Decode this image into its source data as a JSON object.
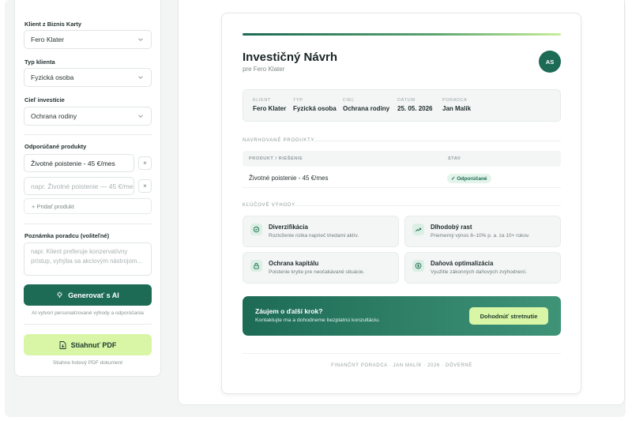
{
  "sidebar": {
    "client_label": "Klient z Biznis Karty",
    "client_value": "Fero Klater",
    "type_label": "Typ klienta",
    "type_value": "Fyzická osoba",
    "goal_label": "Cieľ investície",
    "goal_value": "Ochrana rodiny",
    "products_label": "Odporúčané produkty",
    "products": [
      {
        "value": "Životné poistenie - 45 €/mes"
      }
    ],
    "product_placeholder": "napr. Životné poistenie — 45 €/mes",
    "remove_label": "×",
    "add_product_label": "+ Pridať produkt",
    "note_label": "Poznámka poradcu (voliteľné)",
    "note_placeholder": "napr. Klient preferuje konzervatívny prístup, vyhýba sa akciovým nástrojom...",
    "generate_label": "Generovať s AI",
    "generate_hint": "AI vytvorí personalizované výhody a odporúčania",
    "pdf_label": "Stiahnuť PDF",
    "pdf_hint": "Stiahne hotový PDF dokument"
  },
  "doc": {
    "title": "Investičný Návrh",
    "subtitle": "pre Fero Klater",
    "avatar": "AS",
    "meta": [
      {
        "key": "KLIENT",
        "value": "Fero Klater"
      },
      {
        "key": "TYP",
        "value": "Fyzická osoba"
      },
      {
        "key": "CIEĽ",
        "value": "Ochrana rodiny"
      },
      {
        "key": "DÁTUM",
        "value": "25. 05. 2026"
      },
      {
        "key": "PORADCA",
        "value": "Jan Malík"
      }
    ],
    "products_heading": "NAVRHOVANÉ PRODUKTY",
    "table_headers": [
      "PRODUKT / RIEŠENIE",
      "STAV"
    ],
    "table_rows": [
      {
        "product": "Životné poistenie - 45 €/mes",
        "status": "✓ Odporúčané"
      }
    ],
    "benefits_heading": "KĽÚČOVÉ VÝHODY",
    "benefits": [
      {
        "title": "Diverzifikácia",
        "desc": "Rozloženie rizika naprieč triedami aktív.",
        "icon": "target-icon"
      },
      {
        "title": "Dlhodobý rast",
        "desc": "Priemerný výnos 8–10% p. a. za 10+ rokov.",
        "icon": "trend-up-icon"
      },
      {
        "title": "Ochrana kapitálu",
        "desc": "Poistenie krytie pre neočakávané situácie.",
        "icon": "lock-icon"
      },
      {
        "title": "Daňová optimalizácia",
        "desc": "Využitie zákonných daňových zvýhodnení.",
        "icon": "coin-icon"
      }
    ],
    "cta_title": "Záujem o ďalší krok?",
    "cta_desc": "Kontaktujte ma a dohodneme bezplatnú konzultáciu.",
    "cta_button": "Dohodnúť stretnutie",
    "footer": "FINANČNÝ PORADCA · JAN MALÍK · 2026 · DÔVERNÉ"
  },
  "colors": {
    "primary": "#1d6b55",
    "accent": "#d9f6a6",
    "background": "#f3f5f5"
  }
}
